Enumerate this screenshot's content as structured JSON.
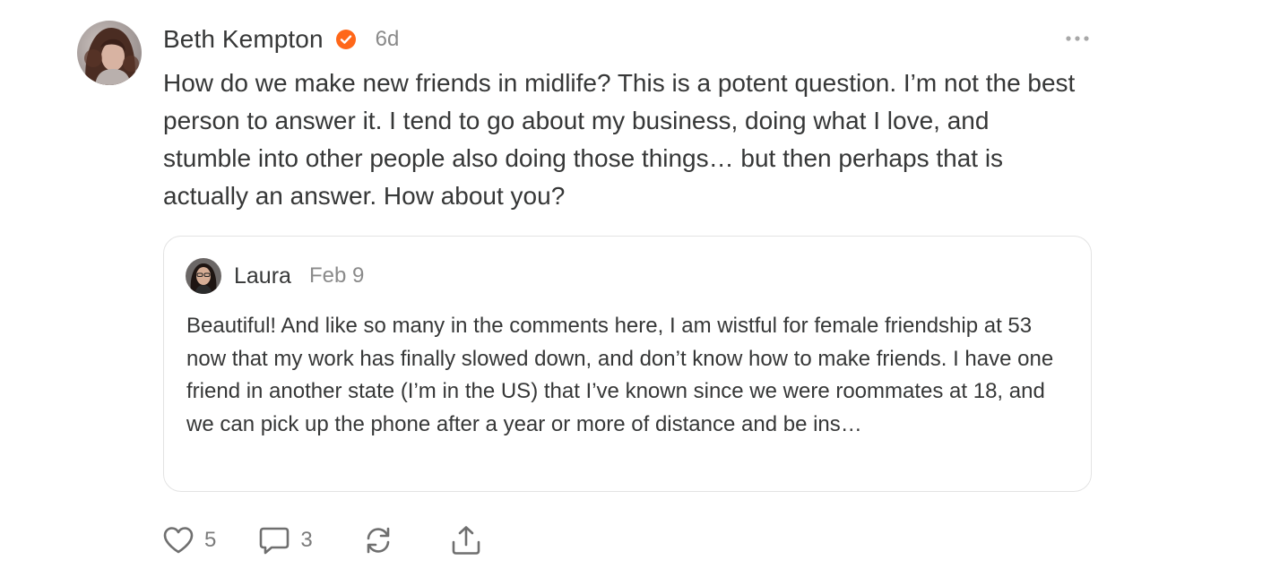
{
  "note": {
    "author": {
      "name": "Beth Kempton",
      "avatar": "avatar-photo",
      "verified_icon": "verified-check-icon",
      "verified_color": "#ff6719"
    },
    "timestamp": "6d",
    "more_icon": "ellipsis-icon",
    "body": "How do we make new friends in midlife? This is a potent question. I’m not the best person to answer it. I tend to go about my business, doing what I love, and stumble into other people also doing those things… but then perhaps that is actually an answer. How about you?",
    "quoted": {
      "author": "Laura",
      "date": "Feb 9",
      "avatar": "avatar-photo",
      "text": "Beautiful! And like so many in the comments here, I am wistful for female friendship at 53 now that my work has finally slowed down, and don’t know how to make friends. I have one friend in another state (I’m in the US) that I’ve known since we were roommates at 18, and we can pick up the phone after a year or more of distance and be ins…"
    },
    "actions": {
      "like": {
        "icon": "heart-icon",
        "count": "5"
      },
      "comment": {
        "icon": "comment-bubble-icon",
        "count": "3"
      },
      "restack": {
        "icon": "restack-icon"
      },
      "share": {
        "icon": "share-upload-icon"
      }
    }
  }
}
